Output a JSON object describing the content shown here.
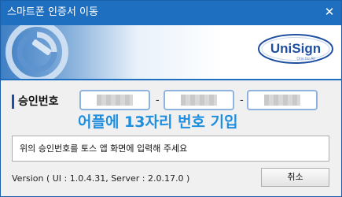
{
  "window": {
    "title": "스마트폰 인증서 이동",
    "close_glyph": "✕"
  },
  "banner": {
    "logo_text": "UniSign",
    "logo_tagline": "One for All",
    "emblem_icon": "certificate-emblem-icon"
  },
  "approval": {
    "label": "승인번호",
    "separator": "-",
    "code_fields": [
      "",
      "",
      ""
    ]
  },
  "overlay_annotation": "어플에 13자리 번호 기입",
  "message": "위의 승인번호를 토스 앱 화면에 입력해 주세요",
  "version": "Version ( UI : 1.0.4.31, Server : 2.0.17.0 )",
  "buttons": {
    "cancel": "취소"
  },
  "colors": {
    "titlebar": "#1f6fc0",
    "accent_text": "#1e8fe0",
    "logo": "#1f4fa0"
  }
}
